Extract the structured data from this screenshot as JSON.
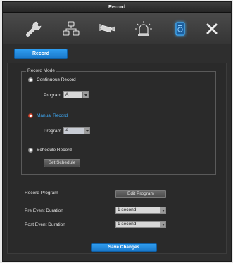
{
  "window": {
    "title": "Record"
  },
  "toolbar": {
    "tools": [
      {
        "icon": "wrench-icon",
        "label": "Settings"
      },
      {
        "icon": "network-icon",
        "label": "Network"
      },
      {
        "icon": "camera-icon",
        "label": "Camera"
      },
      {
        "icon": "alarm-icon",
        "label": "Alarm"
      },
      {
        "icon": "record-icon",
        "label": "Record",
        "active": true
      },
      {
        "icon": "close-icon",
        "label": "Close"
      }
    ]
  },
  "tab": {
    "label": "Record"
  },
  "record_mode": {
    "legend": "Record Mode",
    "continuous": {
      "label": "Continuous Record",
      "program_label": "Program",
      "program_value": "A"
    },
    "manual": {
      "label": "Manual Record",
      "program_label": "Program",
      "program_value": "A",
      "selected": true
    },
    "schedule": {
      "label": "Schedule Record",
      "button_label": "Set Schedule"
    }
  },
  "record_program": {
    "label": "Record Program",
    "button_label": "Edit Program"
  },
  "pre_event": {
    "label": "Pre Event Duration",
    "value": "1 second"
  },
  "post_event": {
    "label": "Post Event Duration",
    "value": "1 second"
  },
  "save": {
    "label": "Save Changes"
  },
  "colors": {
    "accent": "#1e88e5",
    "selected_radio": "#e0503b",
    "selected_label": "#3fa9f5"
  }
}
